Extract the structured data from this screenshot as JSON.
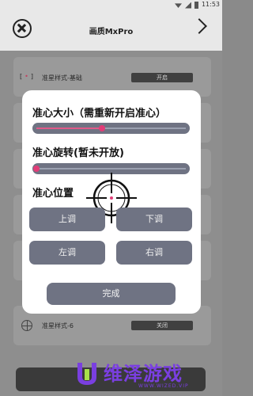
{
  "status_bar": {
    "time": "11:53"
  },
  "header": {
    "title": "画质MxPro"
  },
  "background_list": {
    "row1": {
      "label": "准星样式-基础",
      "toggle": "开启",
      "icon_text": "[ • ]"
    },
    "row6": {
      "label": "准星样式-6",
      "toggle": "关闭"
    }
  },
  "dialog": {
    "size_label": "准心大小（需重新开启准心）",
    "size_value_percent": 44,
    "rotate_label": "准心旋转(暂未开放)",
    "rotate_value_percent": 0,
    "position_label": "准心位置",
    "buttons": {
      "up": "上调",
      "down": "下调",
      "left": "左调",
      "right": "右调"
    },
    "done": "完成"
  },
  "watermark": {
    "title": "维泽游戏",
    "subtitle": "WWW.WIZED.VIP"
  },
  "colors": {
    "accent": "#e23d78",
    "button": "#6f7383",
    "watermark": "#7a3fe0"
  }
}
